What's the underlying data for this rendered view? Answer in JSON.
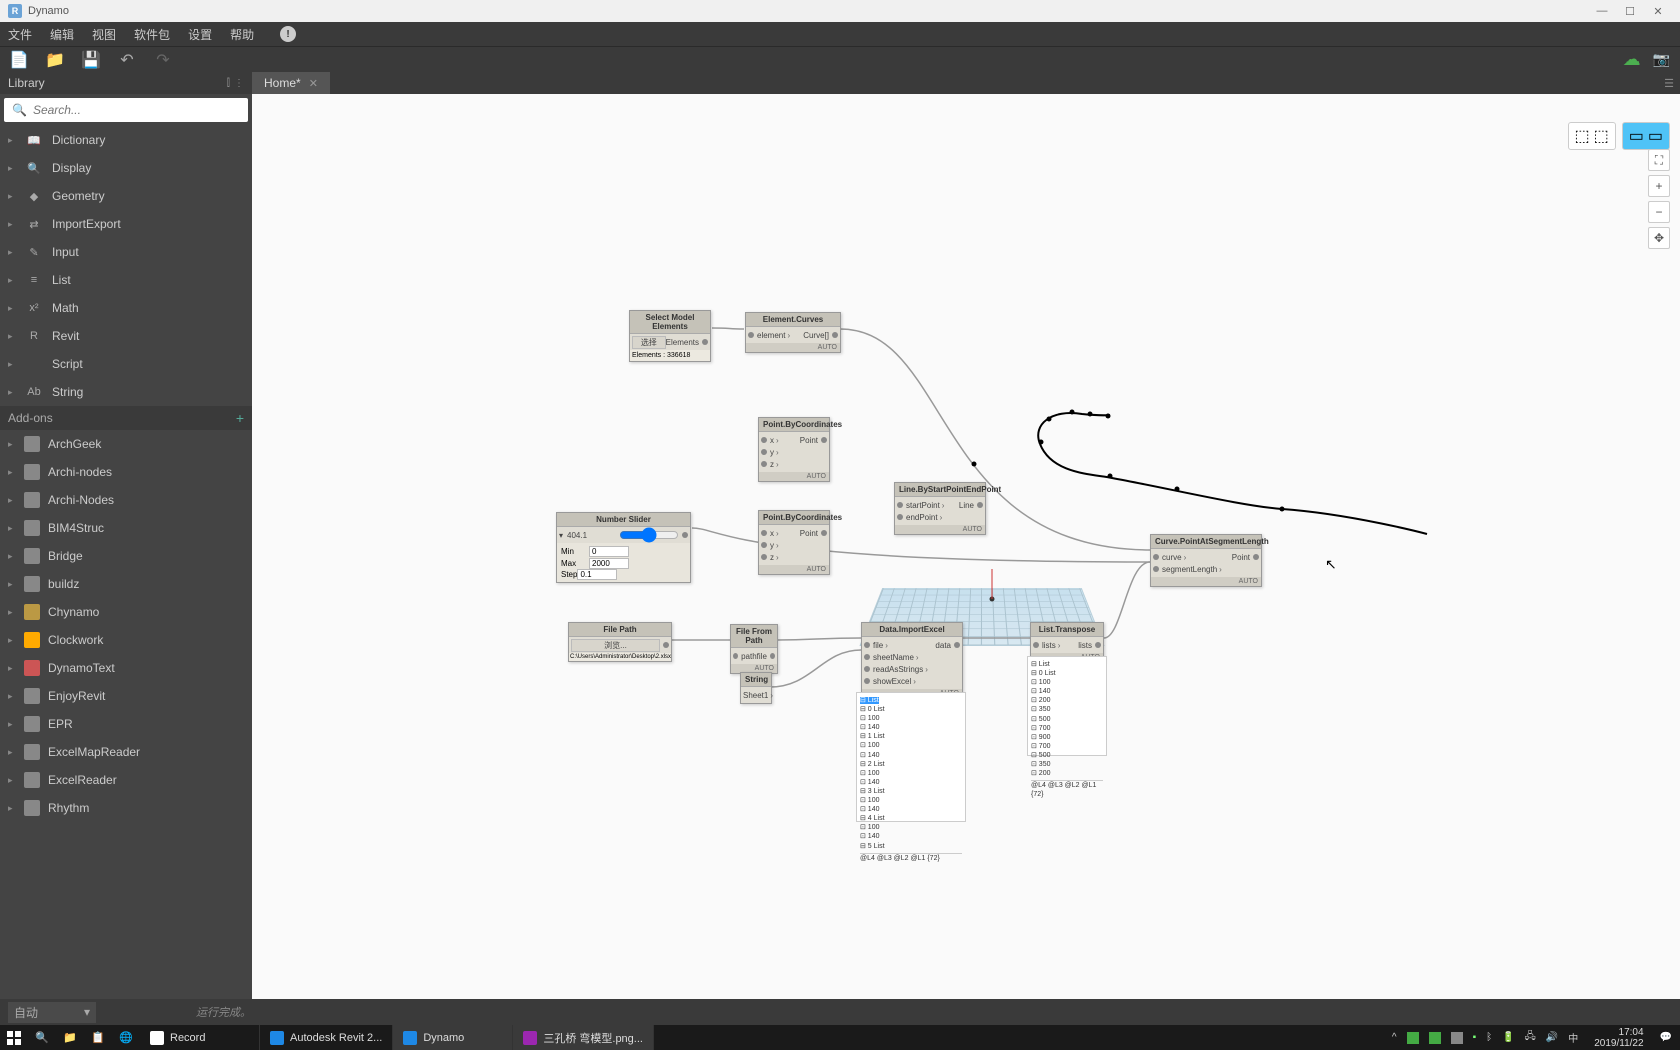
{
  "title": "Dynamo",
  "menu": [
    "文件",
    "编辑",
    "视图",
    "软件包",
    "设置",
    "帮助"
  ],
  "library_header": "Library",
  "search_placeholder": "Search...",
  "categories": [
    {
      "icon": "📖",
      "label": "Dictionary"
    },
    {
      "icon": "🔍",
      "label": "Display"
    },
    {
      "icon": "◆",
      "label": "Geometry"
    },
    {
      "icon": "⇄",
      "label": "ImportExport"
    },
    {
      "icon": "✎",
      "label": "Input"
    },
    {
      "icon": "≡",
      "label": "List"
    },
    {
      "icon": "x²",
      "label": "Math"
    },
    {
      "icon": "R",
      "label": "Revit"
    },
    {
      "icon": "</>",
      "label": "Script"
    },
    {
      "icon": "Ab",
      "label": "String"
    }
  ],
  "addons_header": "Add-ons",
  "addons": [
    {
      "color": "#888",
      "label": "ArchGeek"
    },
    {
      "color": "#888",
      "label": "Archi-nodes"
    },
    {
      "color": "#888",
      "label": "Archi-Nodes"
    },
    {
      "color": "#888",
      "label": "BIM4Struc"
    },
    {
      "color": "#888",
      "label": "Bridge"
    },
    {
      "color": "#888",
      "label": "buildz"
    },
    {
      "color": "#b94",
      "label": "Chynamo"
    },
    {
      "color": "#fa0",
      "label": "Clockwork"
    },
    {
      "color": "#c55",
      "label": "DynamoText"
    },
    {
      "color": "#888",
      "label": "EnjoyRevit"
    },
    {
      "color": "#888",
      "label": "EPR"
    },
    {
      "color": "#888",
      "label": "ExcelMapReader"
    },
    {
      "color": "#888",
      "label": "ExcelReader"
    },
    {
      "color": "#888",
      "label": "Rhythm"
    }
  ],
  "tab_name": "Home*",
  "nodes": {
    "select_model": {
      "title": "Select Model Elements",
      "btn": "选择",
      "out": "Elements",
      "info": "Elements : 336618"
    },
    "element_curves": {
      "title": "Element.Curves",
      "in": "element",
      "out": "Curve[]"
    },
    "point_coord1": {
      "title": "Point.ByCoordinates",
      "ports": [
        "x",
        "y",
        "z"
      ],
      "out": "Point"
    },
    "point_coord2": {
      "title": "Point.ByCoordinates",
      "ports": [
        "x",
        "y",
        "z"
      ],
      "out": "Point"
    },
    "number_slider": {
      "title": "Number Slider",
      "value": "404.1",
      "min": "0",
      "max": "2000",
      "step": "0.1"
    },
    "line_by_pts": {
      "title": "Line.ByStartPointEndPoint",
      "ports": [
        "startPoint",
        "endPoint"
      ],
      "out": "Line"
    },
    "curve_seg": {
      "title": "Curve.PointAtSegmentLength",
      "ports": [
        "curve",
        "segmentLength"
      ],
      "out": "Point"
    },
    "file_path": {
      "title": "File Path",
      "btn": "浏览...",
      "info": "C:\\Users\\Administrator\\Desktop\\2.xlsx"
    },
    "file_from_path": {
      "title": "File From Path",
      "in": "path",
      "out": "file"
    },
    "string": {
      "title": "String",
      "value": "Sheet1"
    },
    "data_import": {
      "title": "Data.ImportExcel",
      "ports": [
        "file",
        "sheetName",
        "readAsStrings",
        "showExcel"
      ],
      "out": "data"
    },
    "list_transpose": {
      "title": "List.Transpose",
      "in": "lists",
      "out": "lists"
    }
  },
  "preview1_lines": [
    "⊟ List",
    "⊟ 0 List",
    "   ⊡ 100",
    "   ⊡ 140",
    "⊟ 1 List",
    "   ⊡ 100",
    "   ⊡ 140",
    "⊟ 2 List",
    "   ⊡ 100",
    "   ⊡ 140",
    "⊟ 3 List",
    "   ⊡ 100",
    "   ⊡ 140",
    "⊟ 4 List",
    "   ⊡ 100",
    "   ⊡ 140",
    "⊟ 5 List"
  ],
  "preview1_footer": "@L4 @L3 @L2 @L1                              {72}",
  "preview2_lines": [
    "⊟ List",
    "⊟ 0 List",
    "   ⊡ 100",
    "   ⊡ 140",
    "   ⊡ 200",
    "   ⊡ 350",
    "   ⊡ 500",
    "   ⊡ 700",
    "   ⊡ 900",
    "   ⊡ 700",
    "   ⊡ 500",
    "   ⊡ 350",
    "   ⊡ 200"
  ],
  "preview2_footer": "@L4 @L3 @L2 @L1           {72}",
  "run_mode": "自动",
  "run_status": "运行完成。",
  "taskbar_items": [
    {
      "label": "Record",
      "color": "#fff",
      "active": false
    },
    {
      "label": "Autodesk Revit 2...",
      "color": "#1e88e5",
      "active": false
    },
    {
      "label": "Dynamo",
      "color": "#1e88e5",
      "active": true
    },
    {
      "label": "三孔桥 弯模型.png...",
      "color": "#9c27b0",
      "active": true
    }
  ],
  "clock": {
    "time": "17:04",
    "date": "2019/11/22"
  },
  "ime": "中"
}
